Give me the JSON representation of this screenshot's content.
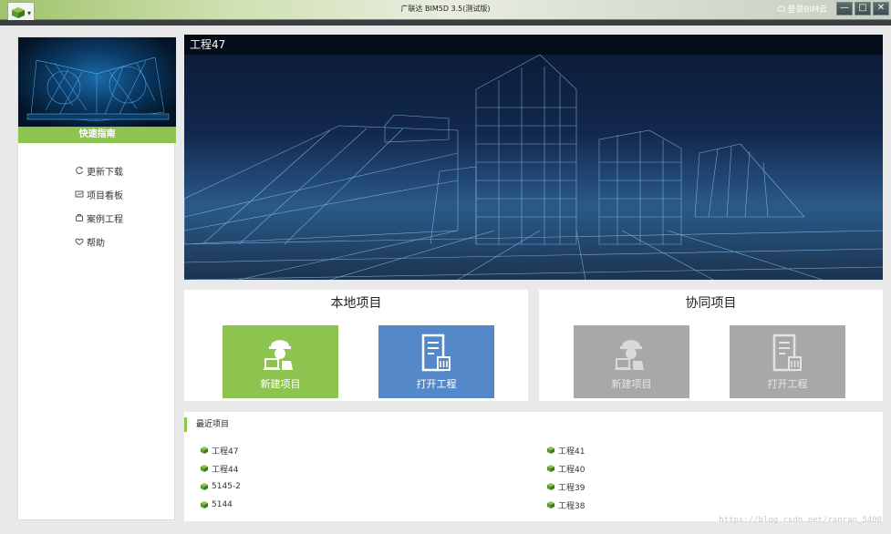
{
  "titlebar": {
    "app_title": "广联达 BIM5D 3.5(测试版)",
    "login_label": "登录BIM云",
    "minimize_label": "—",
    "maximize_label": "□",
    "close_label": "✕"
  },
  "sidebar": {
    "guide_label": "快速指南",
    "items": [
      {
        "label": "更新下载",
        "icon": "refresh-icon"
      },
      {
        "label": "项目看板",
        "icon": "dashboard-icon"
      },
      {
        "label": "案例工程",
        "icon": "case-icon"
      },
      {
        "label": "帮助",
        "icon": "help-icon"
      }
    ]
  },
  "banner": {
    "title": "工程47"
  },
  "local": {
    "title": "本地项目",
    "new_label": "新建项目",
    "open_label": "打开工程"
  },
  "collab": {
    "title": "协同项目",
    "new_label": "新建项目",
    "open_label": "打开工程"
  },
  "recent": {
    "title": "最近项目",
    "left": [
      "工程47",
      "工程44",
      "5145-2",
      "5144"
    ],
    "right": [
      "工程41",
      "工程40",
      "工程39",
      "工程38"
    ]
  },
  "watermark": "https://blog.csdn.net/ranran_5400",
  "colors": {
    "accent_green": "#8dc44f",
    "accent_blue": "#5588c8",
    "disabled_gray": "#a8a8a8"
  }
}
